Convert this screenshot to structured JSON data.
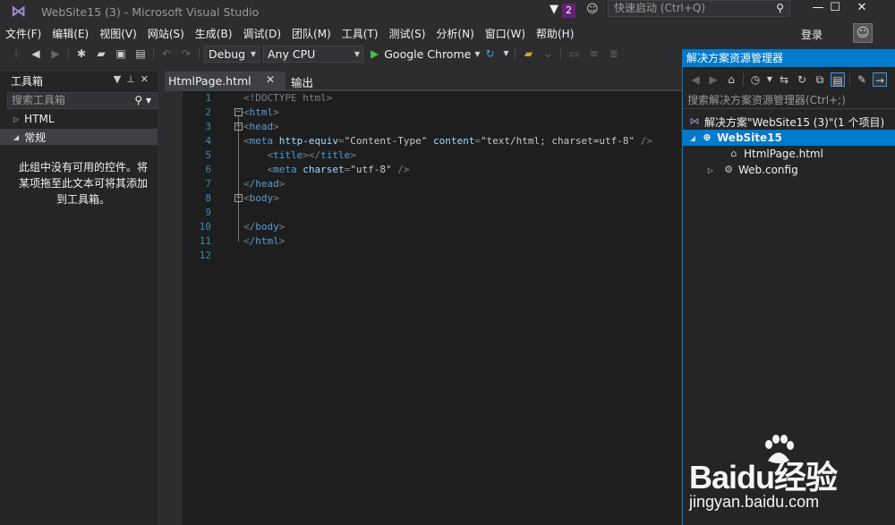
{
  "window": {
    "title": "WebSite15 (3) - Microsoft Visual Studio",
    "notification_count": "2",
    "quick_launch_placeholder": "快速启动 (Ctrl+Q)",
    "min": "—",
    "max": "☐",
    "close": "✕"
  },
  "menu": {
    "items": [
      "文件(F)",
      "编辑(E)",
      "视图(V)",
      "网站(S)",
      "生成(B)",
      "调试(D)",
      "团队(M)",
      "工具(T)",
      "测试(S)",
      "分析(N)",
      "窗口(W)",
      "帮助(H)"
    ],
    "login": "登录"
  },
  "toolbar": {
    "config": "Debug",
    "platform": "Any CPU",
    "run_target": "Google Chrome"
  },
  "toolbox": {
    "title": "工具箱",
    "search_placeholder": "搜索工具箱",
    "groups": [
      {
        "label": "HTML",
        "expanded": false
      },
      {
        "label": "常规",
        "expanded": true
      }
    ],
    "empty_text": "此组中没有可用的控件。将某项拖至此文本可将其添加到工具箱。"
  },
  "editor": {
    "tab_label": "HtmlPage.html",
    "tab_close": "✕",
    "output_tab": "输出",
    "lines": [
      {
        "n": "1"
      },
      {
        "n": "2"
      },
      {
        "n": "3"
      },
      {
        "n": "4"
      },
      {
        "n": "5"
      },
      {
        "n": "6"
      },
      {
        "n": "7"
      },
      {
        "n": "8"
      },
      {
        "n": "9"
      },
      {
        "n": "10"
      },
      {
        "n": "11"
      },
      {
        "n": "12"
      }
    ],
    "code": {
      "doctype": "<!DOCTYPE html>",
      "html_open": "html",
      "head_open": "head",
      "meta1_tag": "meta",
      "meta1_attr1": "http-equiv",
      "meta1_val1": "\"Content-Type\"",
      "meta1_attr2": "content",
      "meta1_val2": "\"text/html; charset=utf-8\"",
      "title_tag": "title",
      "meta2_attr": "charset",
      "meta2_val": "\"utf-8\"",
      "head_close": "/head",
      "body_open": "body",
      "body_close": "/body",
      "html_close": "/html"
    }
  },
  "solution_explorer": {
    "title": "解决方案资源管理器",
    "search_placeholder": "搜索解决方案资源管理器(Ctrl+;)",
    "solution_label": "解决方案\"WebSite15 (3)\"(1 个项目)",
    "project": "WebSite15",
    "items": [
      "HtmlPage.html",
      "Web.config"
    ]
  },
  "watermark": {
    "brand": "Baidu经验",
    "url": "jingyan.baidu.com"
  },
  "colors": {
    "accent": "#007acc",
    "background": "#2d2d30",
    "editor_bg": "#1e1e1e"
  }
}
